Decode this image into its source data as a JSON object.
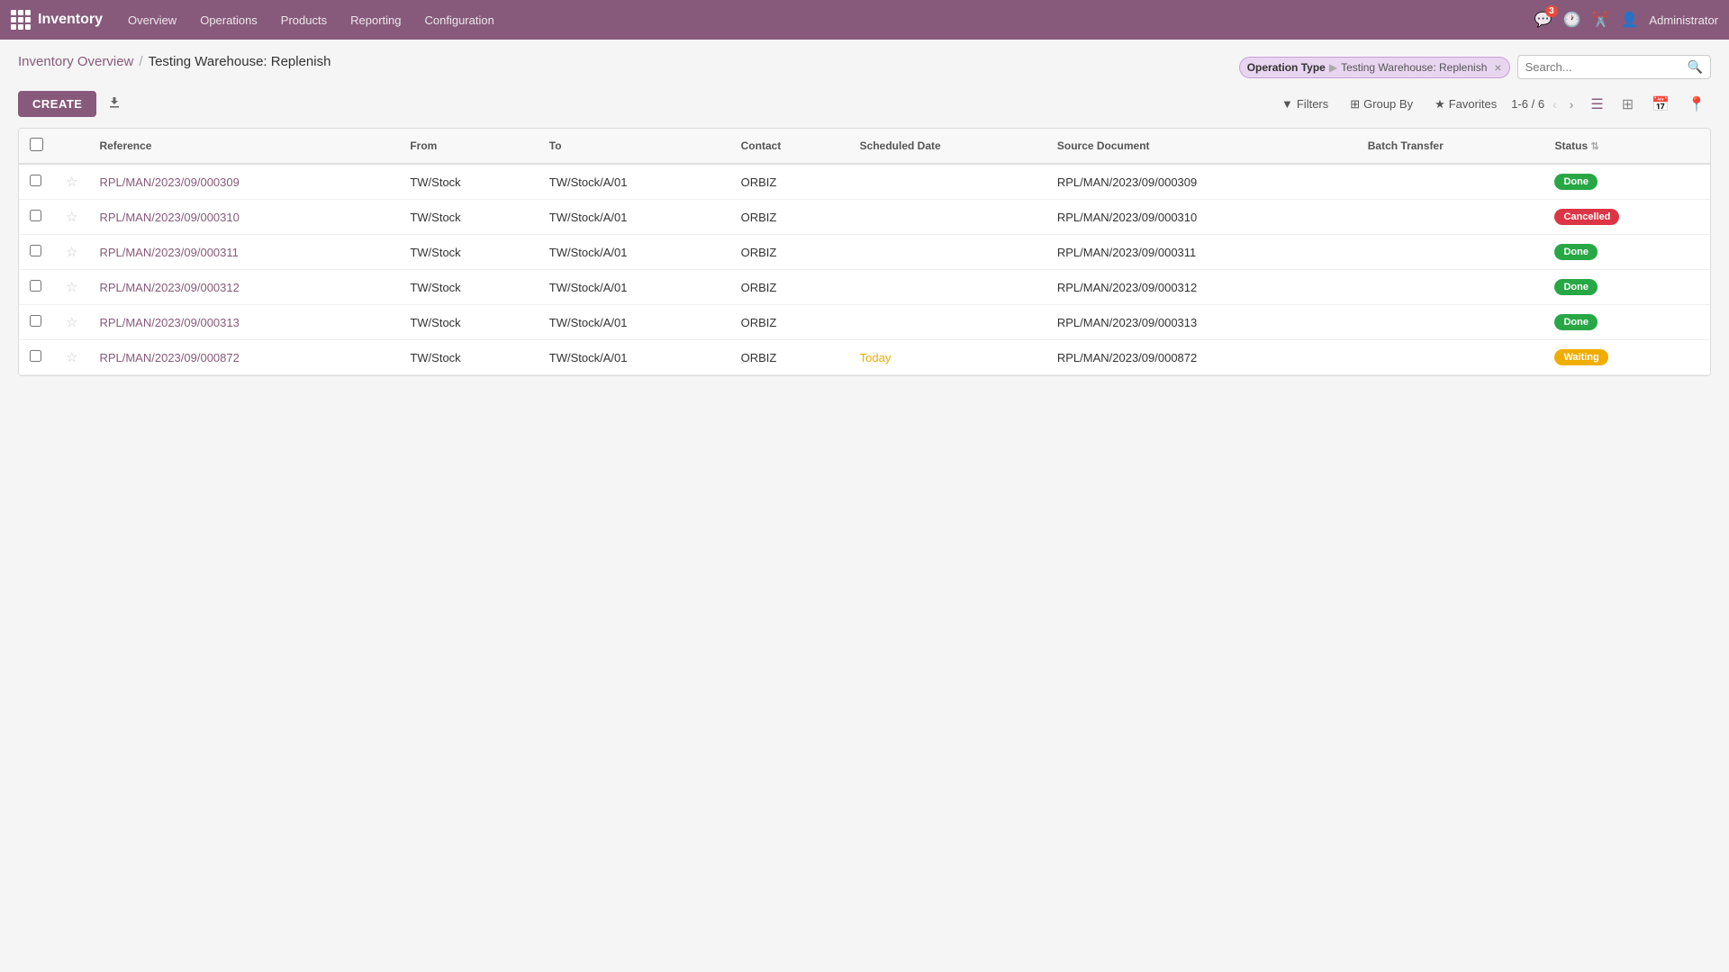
{
  "app": {
    "name": "Inventory",
    "logo_icon": "warehouse-icon"
  },
  "topnav": {
    "menu_items": [
      {
        "label": "Overview",
        "id": "overview"
      },
      {
        "label": "Operations",
        "id": "operations"
      },
      {
        "label": "Products",
        "id": "products"
      },
      {
        "label": "Reporting",
        "id": "reporting"
      },
      {
        "label": "Configuration",
        "id": "configuration"
      }
    ],
    "notification_count": "3",
    "admin_label": "Administrator"
  },
  "breadcrumb": {
    "parent": "Inventory Overview",
    "separator": "/",
    "current": "Testing Warehouse: Replenish"
  },
  "toolbar": {
    "create_label": "CREATE",
    "download_icon": "download-icon"
  },
  "search": {
    "filter_tag_label": "Operation Type",
    "filter_tag_value": "Testing Warehouse: Replenish",
    "placeholder": "Search..."
  },
  "toolbar2": {
    "filters_label": "Filters",
    "group_by_label": "Group By",
    "favorites_label": "Favorites",
    "pagination": "1-6 / 6"
  },
  "table": {
    "columns": [
      {
        "id": "reference",
        "label": "Reference"
      },
      {
        "id": "from",
        "label": "From"
      },
      {
        "id": "to",
        "label": "To"
      },
      {
        "id": "contact",
        "label": "Contact"
      },
      {
        "id": "scheduled_date",
        "label": "Scheduled Date"
      },
      {
        "id": "source_document",
        "label": "Source Document"
      },
      {
        "id": "batch_transfer",
        "label": "Batch Transfer"
      },
      {
        "id": "status",
        "label": "Status"
      }
    ],
    "rows": [
      {
        "id": "row1",
        "reference": "RPL/MAN/2023/09/000309",
        "from": "TW/Stock",
        "to": "TW/Stock/A/01",
        "contact": "ORBIZ",
        "scheduled_date": "",
        "source_document": "RPL/MAN/2023/09/000309",
        "batch_transfer": "",
        "status": "Done",
        "status_class": "done"
      },
      {
        "id": "row2",
        "reference": "RPL/MAN/2023/09/000310",
        "from": "TW/Stock",
        "to": "TW/Stock/A/01",
        "contact": "ORBIZ",
        "scheduled_date": "",
        "source_document": "RPL/MAN/2023/09/000310",
        "batch_transfer": "",
        "status": "Cancelled",
        "status_class": "cancelled"
      },
      {
        "id": "row3",
        "reference": "RPL/MAN/2023/09/000311",
        "from": "TW/Stock",
        "to": "TW/Stock/A/01",
        "contact": "ORBIZ",
        "scheduled_date": "",
        "source_document": "RPL/MAN/2023/09/000311",
        "batch_transfer": "",
        "status": "Done",
        "status_class": "done"
      },
      {
        "id": "row4",
        "reference": "RPL/MAN/2023/09/000312",
        "from": "TW/Stock",
        "to": "TW/Stock/A/01",
        "contact": "ORBIZ",
        "scheduled_date": "",
        "source_document": "RPL/MAN/2023/09/000312",
        "batch_transfer": "",
        "status": "Done",
        "status_class": "done"
      },
      {
        "id": "row5",
        "reference": "RPL/MAN/2023/09/000313",
        "from": "TW/Stock",
        "to": "TW/Stock/A/01",
        "contact": "ORBIZ",
        "scheduled_date": "",
        "source_document": "RPL/MAN/2023/09/000313",
        "batch_transfer": "",
        "status": "Done",
        "status_class": "done"
      },
      {
        "id": "row6",
        "reference": "RPL/MAN/2023/09/000872",
        "from": "TW/Stock",
        "to": "TW/Stock/A/01",
        "contact": "ORBIZ",
        "scheduled_date": "Today",
        "source_document": "RPL/MAN/2023/09/000872",
        "batch_transfer": "",
        "status": "Waiting",
        "status_class": "waiting"
      }
    ]
  }
}
